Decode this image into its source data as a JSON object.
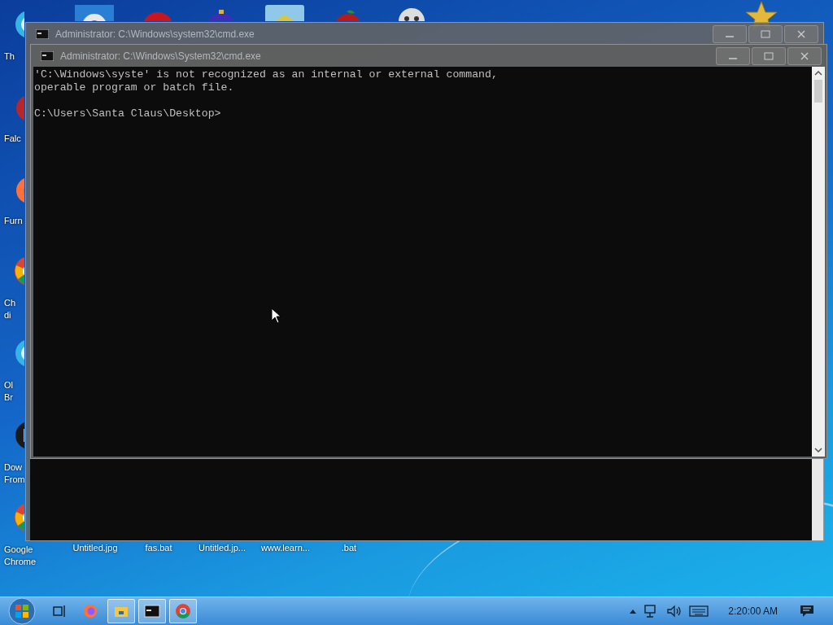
{
  "desktop": {
    "left_icons": [
      {
        "kind": "globe",
        "lines": [
          "Th"
        ]
      },
      {
        "kind": "ornament",
        "lines": [
          "Falc"
        ]
      },
      {
        "kind": "firefox",
        "lines": [
          "Furn"
        ]
      },
      {
        "kind": "chrome",
        "lines": [
          "Ch",
          "di"
        ]
      },
      {
        "kind": "globe",
        "lines": [
          "Ol",
          "Br"
        ]
      },
      {
        "kind": "dark",
        "lines": [
          "Dow",
          "From"
        ]
      },
      {
        "kind": "chrome",
        "lines": [
          "Google",
          "Chrome"
        ]
      }
    ],
    "bottom_icons": [
      {
        "label": "Untitled.jpg"
      },
      {
        "label": "fas.bat"
      },
      {
        "label": "Untitled.jp..."
      },
      {
        "label": "www.learn..."
      },
      {
        "label": ".bat"
      }
    ]
  },
  "windows": [
    {
      "title": "Administrator: C:\\Windows\\system32\\cmd.exe"
    },
    {
      "title": "Administrator: C:\\Windows\\System32\\cmd.exe",
      "output_lines": [
        "'C:\\Windows\\syste' is not recognized as an internal or external command,",
        "operable program or batch file."
      ],
      "prompt": "C:\\Users\\Santa Claus\\Desktop>"
    }
  ],
  "taskbar": {
    "apps": [
      {
        "kind": "taskview",
        "running": false
      },
      {
        "kind": "firefox",
        "running": false
      },
      {
        "kind": "explorer",
        "running": true
      },
      {
        "kind": "cmd",
        "running": true
      },
      {
        "kind": "chrome",
        "running": true
      }
    ],
    "clock": "2:20:00 AM"
  }
}
